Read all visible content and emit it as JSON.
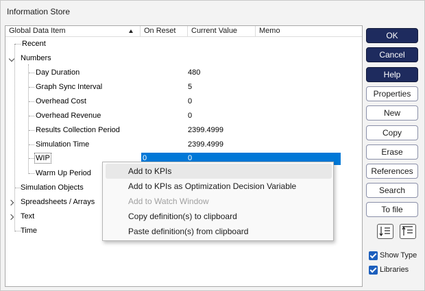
{
  "window": {
    "title": "Information Store"
  },
  "columns": {
    "global_data_item": "Global Data Item",
    "on_reset": "On Reset",
    "current_value": "Current Value",
    "memo": "Memo"
  },
  "tree": {
    "recent": "Recent",
    "numbers": "Numbers",
    "number_items": [
      {
        "label": "Day Duration",
        "value": "480"
      },
      {
        "label": "Graph Sync Interval",
        "value": "5"
      },
      {
        "label": "Overhead Cost",
        "value": "0"
      },
      {
        "label": "Overhead Revenue",
        "value": "0"
      },
      {
        "label": "Results Collection Period",
        "value": "2399.4999"
      },
      {
        "label": "Simulation Time",
        "value": "2399.4999"
      },
      {
        "label": "WIP",
        "on_reset": "0",
        "value": "0"
      },
      {
        "label": "Warm Up Period",
        "value": ""
      }
    ],
    "simulation_objects": "Simulation Objects",
    "spreadsheets_arrays": "Spreadsheets / Arrays",
    "text": "Text",
    "time": "Time"
  },
  "buttons": {
    "ok": "OK",
    "cancel": "Cancel",
    "help": "Help",
    "properties": "Properties",
    "new": "New",
    "copy": "Copy",
    "erase": "Erase",
    "references": "References",
    "search": "Search",
    "to_file": "To file"
  },
  "checkboxes": {
    "show_type": {
      "label": "Show Type",
      "checked": true
    },
    "libraries": {
      "label": "Libraries",
      "checked": true
    }
  },
  "context_menu": {
    "items": [
      {
        "label": "Add to KPIs",
        "state": "hover"
      },
      {
        "label": "Add to KPIs as Optimization Decision Variable",
        "state": "normal"
      },
      {
        "label": "Add to Watch Window",
        "state": "disabled"
      },
      {
        "label": "Copy definition(s) to clipboard",
        "state": "normal"
      },
      {
        "label": "Paste definition(s) from clipboard",
        "state": "normal"
      }
    ]
  },
  "icons": {
    "expand_open": "chevron-down-icon",
    "expand_closed": "chevron-right-icon",
    "sort": "sort-ascending-icon",
    "list_collapse": "list-collapse-icon",
    "list_expand": "list-expand-icon"
  },
  "colors": {
    "primary_button": "#1e2b5e",
    "selection": "#0078d7",
    "checkbox": "#1c5fbd"
  }
}
